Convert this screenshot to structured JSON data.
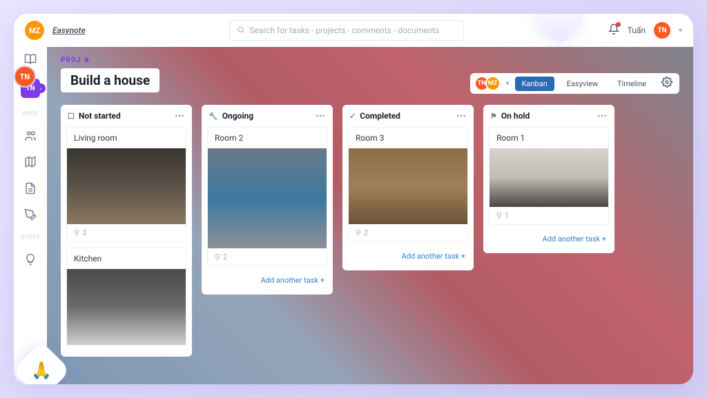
{
  "topbar": {
    "avatar1": "MZ",
    "logo": "Easynote",
    "search_placeholder": "Search for tasks - projects - comments - documents",
    "user_name": "Tuấn",
    "user_avatar": "TN"
  },
  "sidebar": {
    "workspace_avatar": "TN",
    "section_apps": "APPS",
    "section_other": "OTHER"
  },
  "project": {
    "tag": "PROJ",
    "title": "Build a house",
    "member1": "TN",
    "member2": "MZ",
    "views": {
      "kanban": "Kanban",
      "easyview": "Easyview",
      "timeline": "Timeline"
    }
  },
  "columns": [
    {
      "title": "Not started",
      "cards": [
        {
          "title": "Living room",
          "attachments": "2"
        },
        {
          "title": "Kitchen"
        }
      ]
    },
    {
      "title": "Ongoing",
      "cards": [
        {
          "title": "Room 2",
          "attachments": "2"
        }
      ],
      "add": "Add another task +"
    },
    {
      "title": "Completed",
      "cards": [
        {
          "title": "Room 3",
          "attachments": "2"
        }
      ],
      "add": "Add another task +"
    },
    {
      "title": "On hold",
      "cards": [
        {
          "title": "Room 1",
          "attachments": "1"
        }
      ],
      "add": "Add another task +"
    }
  ],
  "float_avatar": "TN"
}
